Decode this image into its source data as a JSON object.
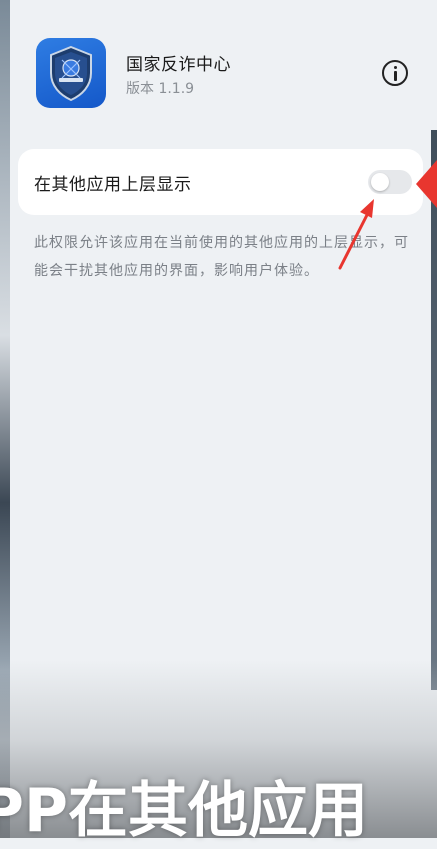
{
  "app": {
    "name": "国家反诈中心",
    "version": "版本 1.1.9"
  },
  "permission": {
    "label": "在其他应用上层显示",
    "enabled": false,
    "description": "此权限允许该应用在当前使用的其他应用的上层显示，可能会干扰其他应用的界面，影响用户体验。"
  },
  "overlay": {
    "caption": "PP在其他应用"
  },
  "colors": {
    "app_icon": "#1458c9",
    "annotation_arrow": "#e8362f",
    "card_bg": "#ffffff",
    "page_bg": "#eef1f4"
  },
  "icons": {
    "info": "info-circle-icon",
    "app": "shield-badge-icon"
  }
}
